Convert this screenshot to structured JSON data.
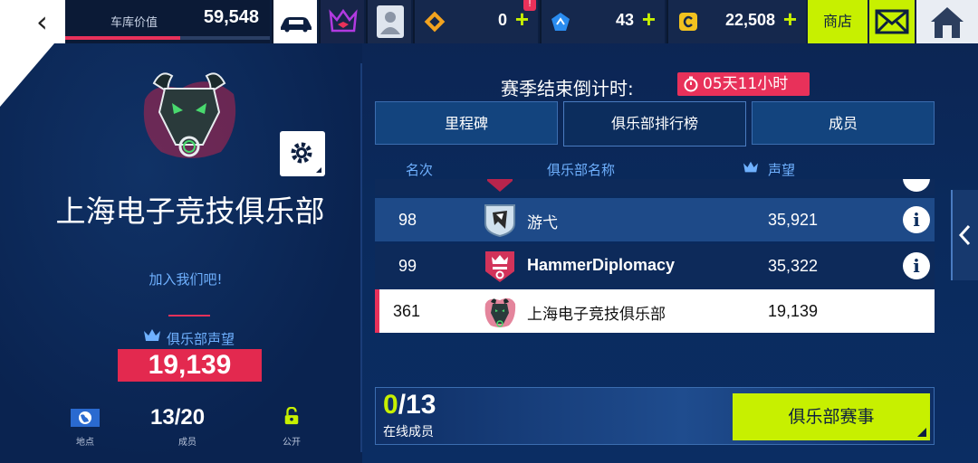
{
  "topbar": {
    "garage_label": "车库价值",
    "garage_value": "59,548",
    "garage_progress": 0.56,
    "currency1": "0",
    "currency2": "43",
    "currency3": "22,508",
    "shop_label": "商店",
    "plus": "+",
    "notice": "!"
  },
  "club": {
    "name": "上海电子竞技俱乐部",
    "join": "加入我们吧!",
    "rep_label": "俱乐部声望",
    "rep_value": "19,139",
    "location_label": "地点",
    "members_value": "13/20",
    "members_label": "成员",
    "open_label": "公开"
  },
  "season": {
    "countdown_label": "赛季结束倒计时:",
    "countdown_value": "05天11小时"
  },
  "tabs": [
    {
      "label": "里程碑"
    },
    {
      "label": "俱乐部排行榜"
    },
    {
      "label": "成员"
    }
  ],
  "columns": {
    "rank": "名次",
    "name": "俱乐部名称",
    "rep": "声望"
  },
  "rows": [
    {
      "rank": "98",
      "name": "游弋",
      "rep": "35,921"
    },
    {
      "rank": "99",
      "name": "HammerDiplomacy",
      "rep": "35,322"
    },
    {
      "rank": "361",
      "name": "上海电子竞技俱乐部",
      "rep": "19,139"
    }
  ],
  "footer": {
    "online_count": "0",
    "online_total": "/13",
    "online_label": "在线成员",
    "event_button": "俱乐部赛事"
  },
  "colors": {
    "accent_lime": "#c7f000",
    "accent_red": "#e8315a",
    "panel_blue": "#13447e"
  }
}
